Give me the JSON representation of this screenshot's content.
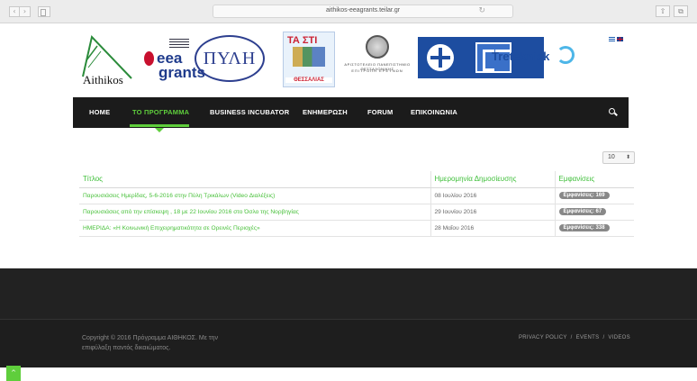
{
  "browser": {
    "url": "aithikos-eeagrants.teilar.gr",
    "back_glyph": "‹",
    "forward_glyph": "›",
    "reload_glyph": "↻",
    "share_glyph": "⇧",
    "tabs_glyph": "⧉"
  },
  "logos": {
    "aithikos": "Aithikos",
    "eea_line1": "eea",
    "eea_line2": "grants",
    "pyli": "ΠΥΛΗ",
    "thessalia_top": "ΤΑ ΣΤΙ",
    "thessalia_bottom": "ΘΕΣΣΑΛΙΑΣ",
    "university_line1": "ΑΡΙΣΤΟΤΕΛΕΙΟ ΠΑΝΕΠΙΣΤΗΜΙΟ ΘΕΣΣΑΛΟΝΙΚΗΣ",
    "university_line2": "ΕΠΙΤΡΟΠΗ ΕΡΕΥΝΩΝ",
    "treteknisk": "Treteknisk"
  },
  "nav": {
    "items": [
      "HOME",
      "ΤΟ ΠΡΟΓΡΑΜΜΑ",
      "BUSINESS INCUBATOR",
      "ΕΝΗΜΕΡΩΣΗ",
      "FORUM",
      "ΕΠΙΚΟΙΝΩΝΙΑ"
    ],
    "active": "ΤΟ ΠΡΟΓΡΑΜΜΑ"
  },
  "page_size": {
    "value": "10",
    "arrows": "⬍"
  },
  "table": {
    "headers": [
      "Τίτλος",
      "Ημερομηνία Δημοσίευσης",
      "Εμφανίσεις"
    ],
    "rows": [
      {
        "title": "Παρουσιάσεις Ημερίδας, 5-6-2016 στην Πύλη Τρικάλων (Video Διαλέξεις)",
        "date": "08 Ιουλίου 2016",
        "views": "Εμφανίσεις: 169"
      },
      {
        "title": "Παρουσιάσεις από την επίσκεψη , 18 με 22 Ιουνίου 2016 στο Όσλο της Νορβηγίας",
        "date": "29 Ιουνίου 2016",
        "views": "Εμφανίσεις: 67"
      },
      {
        "title": "ΗΜΕΡΙΔΑ: «Η Κοινωνική Επιχειρηματικότητα σε Ορεινές Περιοχές»",
        "date": "28 Μαΐου 2016",
        "views": "Εμφανίσεις: 338"
      }
    ]
  },
  "footer": {
    "copyright_line1": "Copyright © 2016 Πρόγραμμα ΑΙΘΗΚΟΣ. Με την",
    "copyright_line2": "επιφύλαξη παντός δικαιώματος.",
    "links": [
      "PRIVACY POLICY",
      "EVENTS",
      "VIDEOS"
    ],
    "separator": "/"
  },
  "to_top": "^",
  "colors": {
    "accent": "#5fce3c",
    "nav_bg": "#1b1b1b",
    "footer_bg": "#222222"
  }
}
